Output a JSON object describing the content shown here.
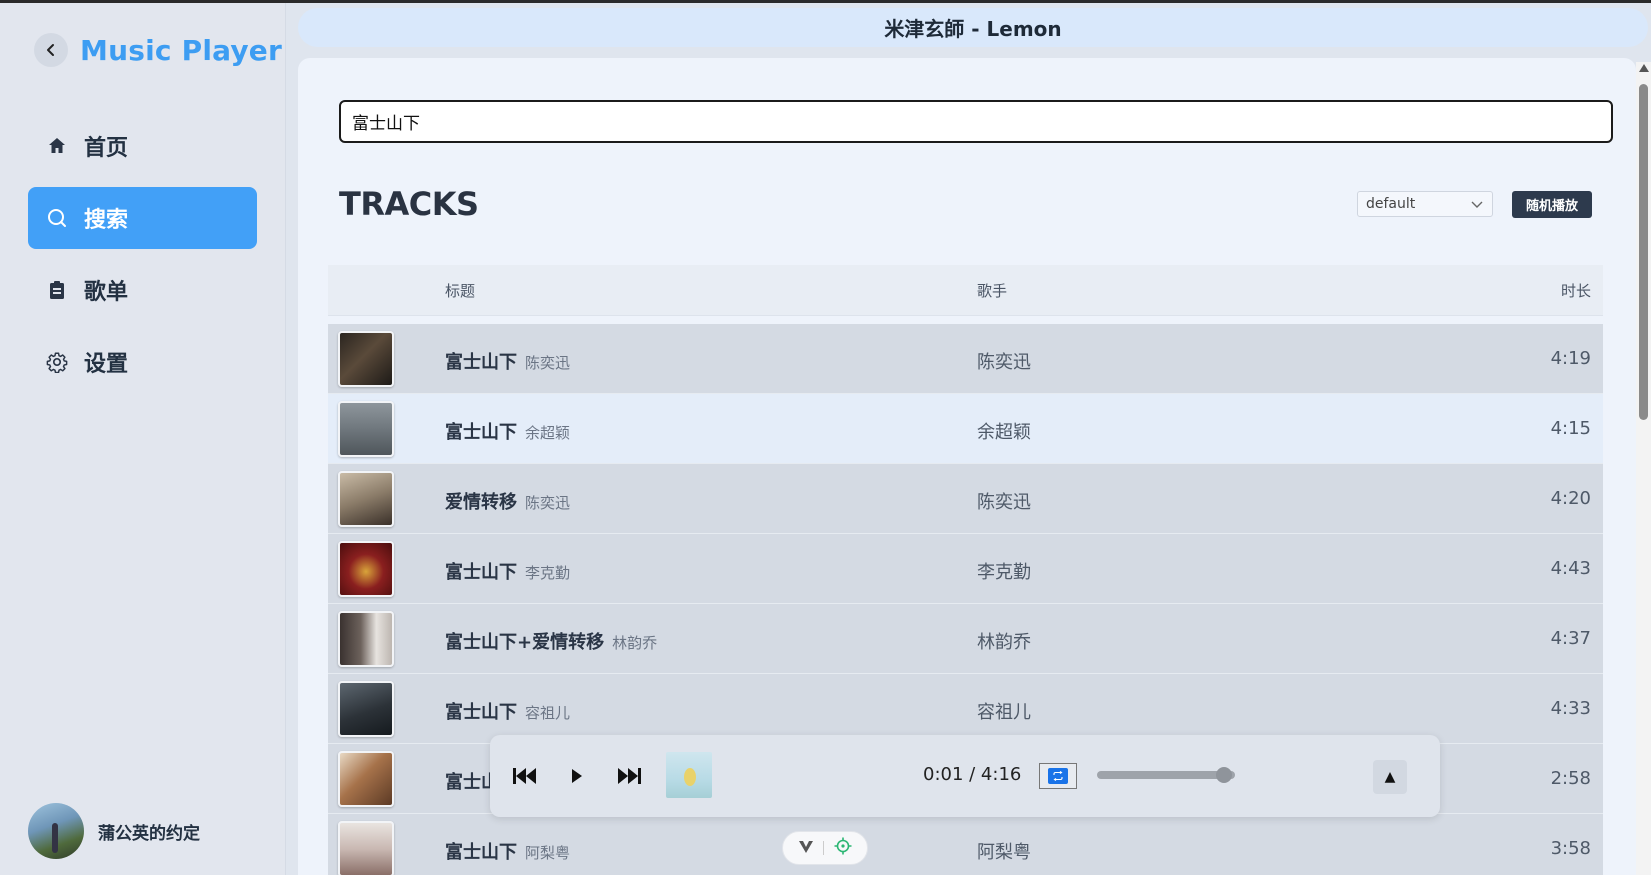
{
  "app": {
    "title": "Music Player",
    "now_playing_title": "米津玄師 - Lemon"
  },
  "sidebar": {
    "items": [
      {
        "label": "首页",
        "icon": "home-icon"
      },
      {
        "label": "搜索",
        "icon": "search-icon",
        "active": true
      },
      {
        "label": "歌单",
        "icon": "clipboard-icon"
      },
      {
        "label": "设置",
        "icon": "gear-icon"
      }
    ],
    "user": {
      "name": "蒲公英的约定"
    }
  },
  "search": {
    "value": "富士山下"
  },
  "section": {
    "title": "TRACKS"
  },
  "sort": {
    "selected": "default"
  },
  "shuffle_label": "随机播放",
  "table": {
    "headers": {
      "title": "标题",
      "artist": "歌手",
      "duration": "时长"
    },
    "rows": [
      {
        "title": "富士山下",
        "sub": "陈奕迅",
        "artist": "陈奕迅",
        "duration": "4:19"
      },
      {
        "title": "富士山下",
        "sub": "余超颖",
        "artist": "余超颖",
        "duration": "4:15"
      },
      {
        "title": "爱情转移",
        "sub": "陈奕迅",
        "artist": "陈奕迅",
        "duration": "4:20"
      },
      {
        "title": "富士山下",
        "sub": "李克勤",
        "artist": "李克勤",
        "duration": "4:43"
      },
      {
        "title": "富士山下+爱情转移",
        "sub": "林韵乔",
        "artist": "林韵乔",
        "duration": "4:37"
      },
      {
        "title": "富士山下",
        "sub": "容祖儿",
        "artist": "容祖儿",
        "duration": "4:33"
      },
      {
        "title": "富士山",
        "sub": "",
        "artist": "",
        "duration": "2:58"
      },
      {
        "title": "富士山下",
        "sub": "阿梨粤",
        "artist": "阿梨粤",
        "duration": "3:58"
      }
    ]
  },
  "player": {
    "time": "0:01 / 4:16",
    "volume_fraction": 0.92
  },
  "colors": {
    "accent": "#42a0f7",
    "brand": "#3d9df2",
    "shuffle_bg": "#2d3a4d"
  }
}
